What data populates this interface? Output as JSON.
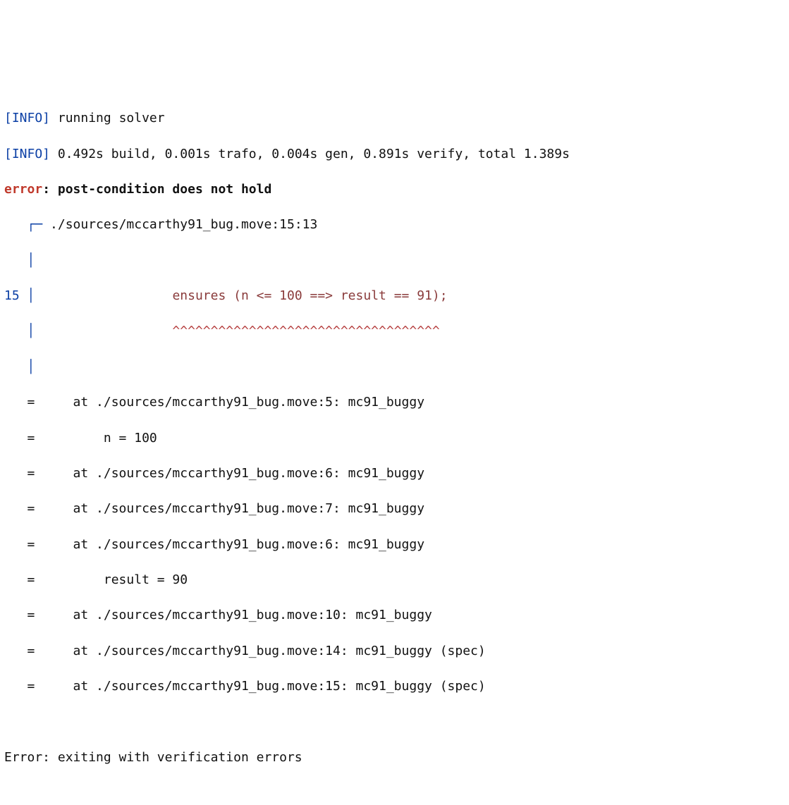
{
  "log": {
    "lines": [
      {
        "tag": "[INFO]",
        "msg": " running solver"
      },
      {
        "tag": "[INFO]",
        "msg": " 0.492s build, 0.001s trafo, 0.004s gen, 0.891s verify, total 1.389s"
      }
    ]
  },
  "error_header": {
    "label": "error",
    "colon": ": ",
    "message": "post-condition does not hold"
  },
  "location": {
    "prefix": "   ┌─ ",
    "path": "./sources/mccarthy91_bug.move:15:13"
  },
  "gutter_blank": "   │ ",
  "snippet": {
    "lineno": "15",
    "gutter": " │ ",
    "indent": "                 ",
    "text": "ensures (n <= 100 ==> result == 91);",
    "caret_gutter": "   │ ",
    "caret_indent": "                 ",
    "carets": "^^^^^^^^^^^^^^^^^^^^^^^^^^^^^^^^^^^"
  },
  "trace": [
    "   =     at ./sources/mccarthy91_bug.move:5: mc91_buggy",
    "   =         n = 100",
    "   =     at ./sources/mccarthy91_bug.move:6: mc91_buggy",
    "   =     at ./sources/mccarthy91_bug.move:7: mc91_buggy",
    "   =     at ./sources/mccarthy91_bug.move:6: mc91_buggy",
    "   =         result = 90",
    "   =     at ./sources/mccarthy91_bug.move:10: mc91_buggy",
    "   =     at ./sources/mccarthy91_bug.move:14: mc91_buggy (spec)",
    "   =     at ./sources/mccarthy91_bug.move:15: mc91_buggy (spec)"
  ],
  "footer": "Error: exiting with verification errors"
}
